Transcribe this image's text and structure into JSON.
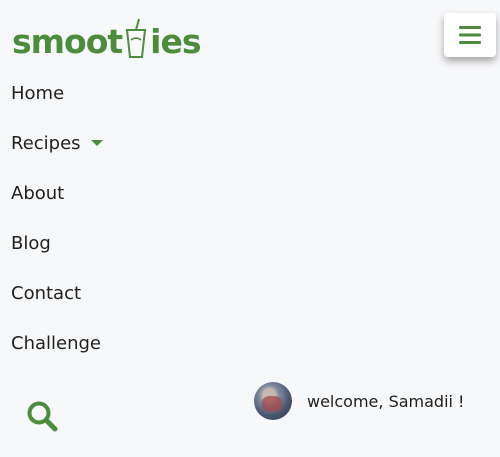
{
  "brand": {
    "logo_before": "smoot",
    "logo_after": "ies",
    "color": "#4c8c3c"
  },
  "header": {
    "menu_icon": "hamburger-icon"
  },
  "nav": {
    "items": [
      {
        "label": "Home"
      },
      {
        "label": "Recipes",
        "has_dropdown": true
      },
      {
        "label": "About"
      },
      {
        "label": "Blog"
      },
      {
        "label": "Contact"
      },
      {
        "label": "Challenge"
      }
    ]
  },
  "search": {
    "icon": "search-icon"
  },
  "user": {
    "welcome_text": "welcome, Samadii !"
  }
}
